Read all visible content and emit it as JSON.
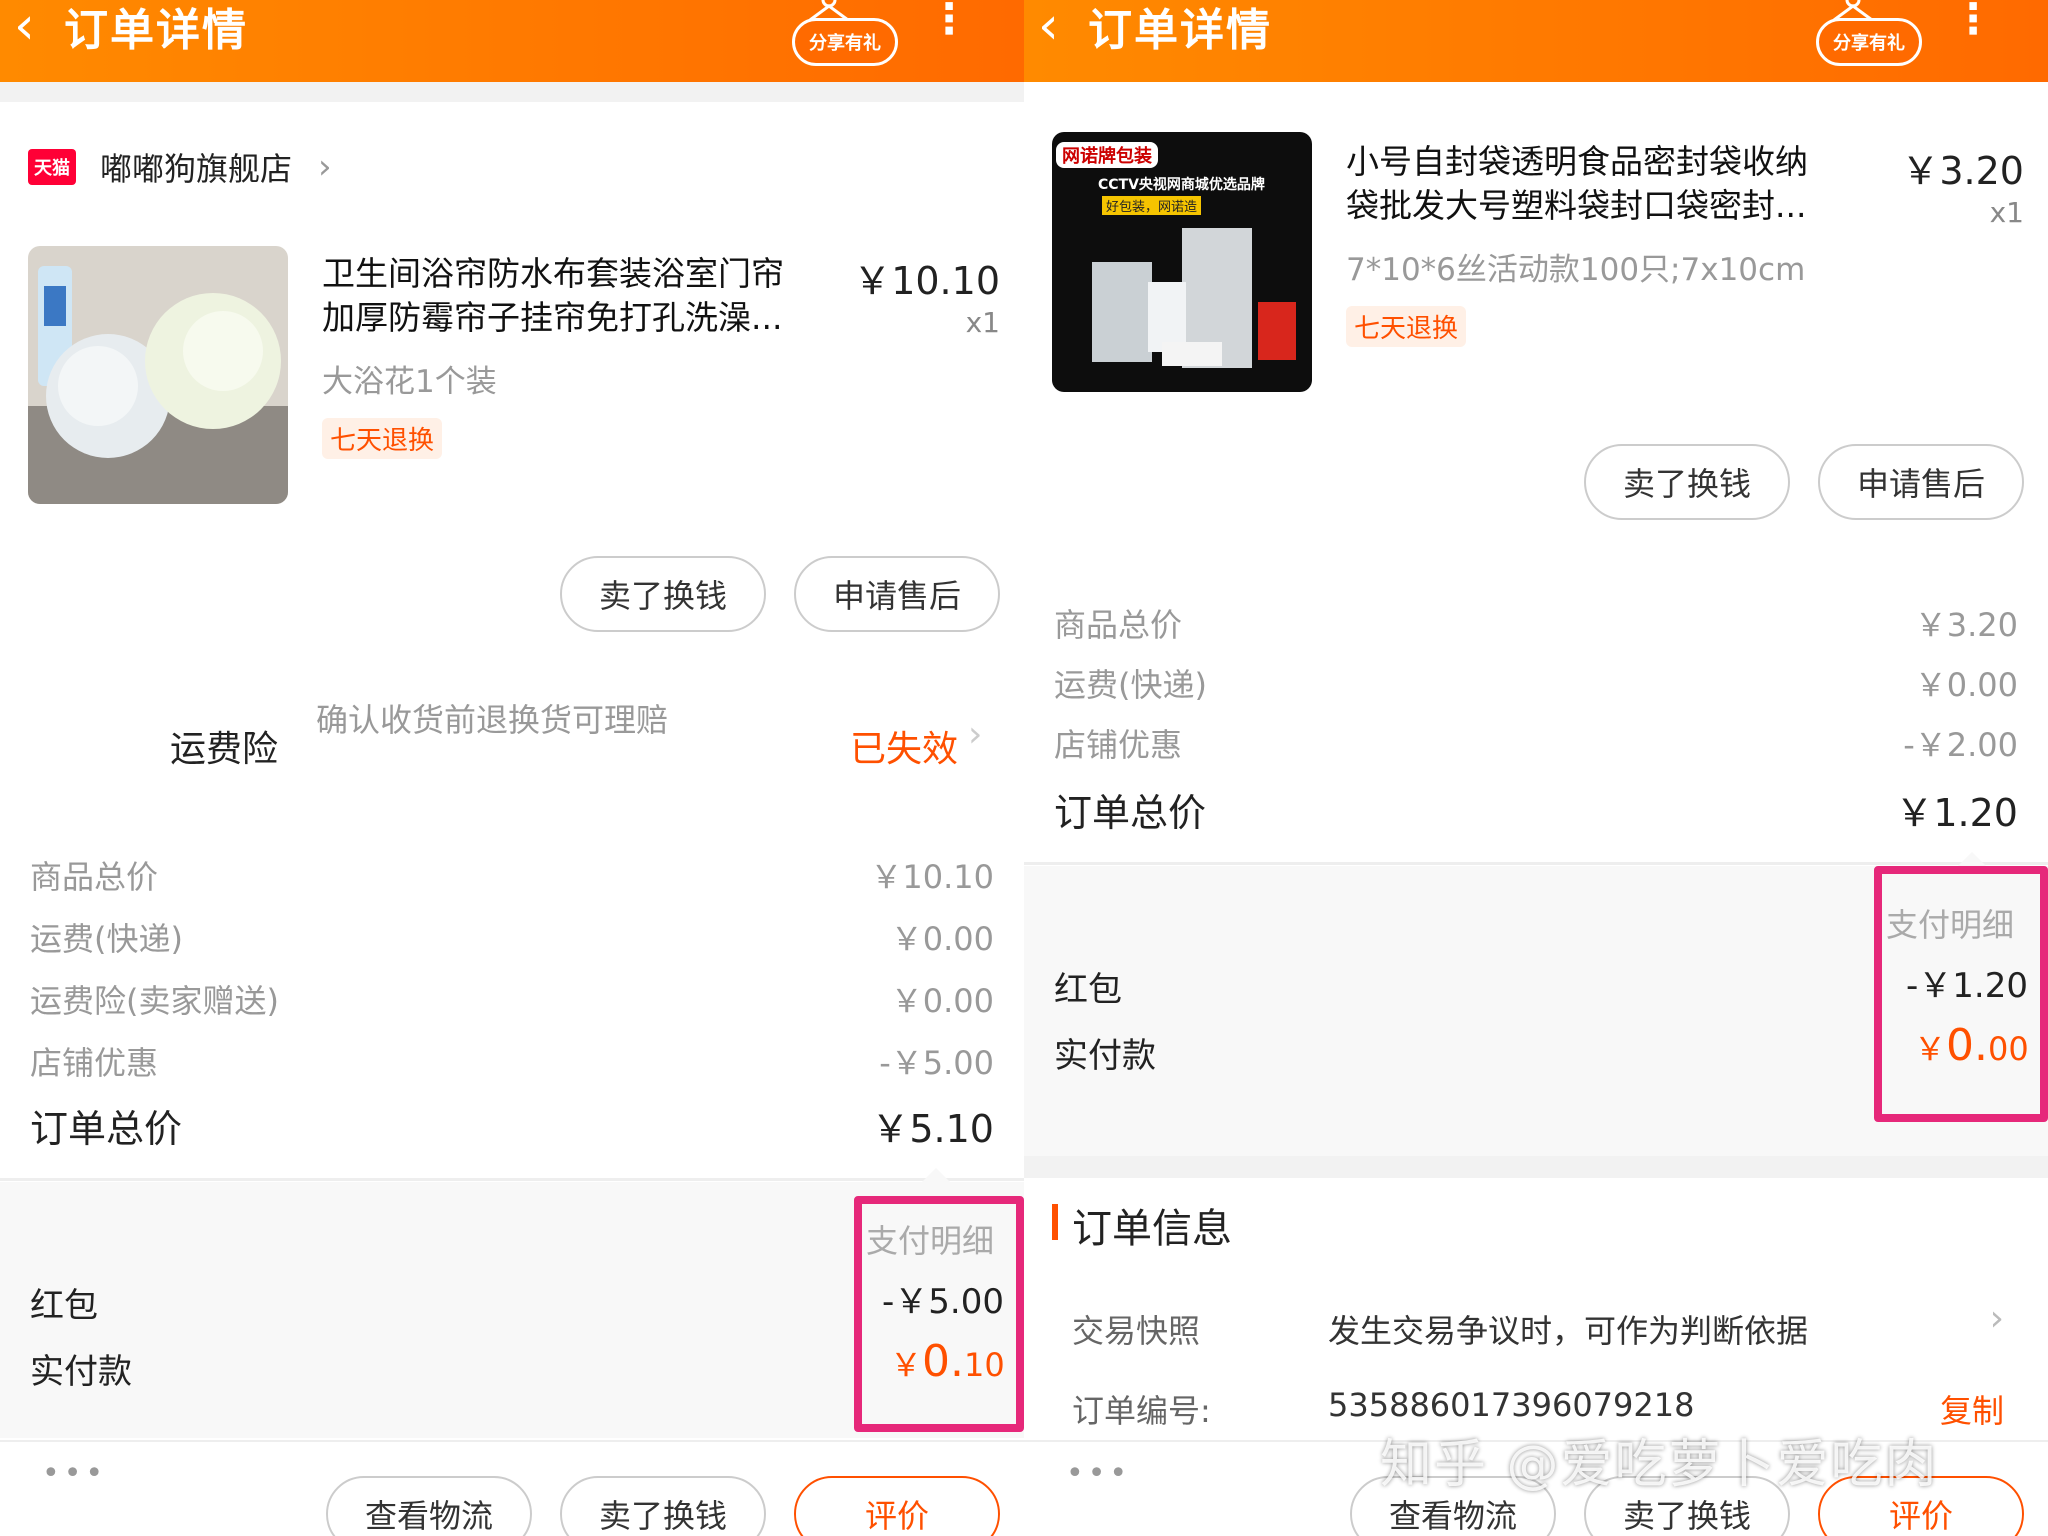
{
  "topbar": {
    "back_glyph": "‹",
    "title": "订单详情",
    "share_label": "分享有礼",
    "more_glyph": "⋮"
  },
  "left": {
    "store": {
      "badge": "天猫",
      "name": "嘟嘟狗旗舰店",
      "chevron": "›"
    },
    "product": {
      "title_line1": "卫生间浴帘防水布套装浴室门帘",
      "title_line2": "加厚防霉帘子挂帘免打孔洗澡...",
      "price": "￥10.10",
      "qty": "x1",
      "sku": "大浴花1个装",
      "tag": "七天退换"
    },
    "buttons": {
      "sell": "卖了换钱",
      "after_sale": "申请售后"
    },
    "insurance": {
      "label": "运费险",
      "desc": "确认收货前退换货可理赔",
      "status": "已失效",
      "chevron": "›"
    },
    "summary": [
      {
        "k": "商品总价",
        "v": "￥10.10"
      },
      {
        "k": "运费(快递)",
        "v": "￥0.00"
      },
      {
        "k": "运费险(卖家赠送)",
        "v": "￥0.00"
      },
      {
        "k": "店铺优惠",
        "v": "-￥5.00"
      }
    ],
    "total": {
      "k": "订单总价",
      "v": "￥5.10"
    },
    "payment": {
      "detail": "支付明细",
      "red_packet": "红包",
      "red_packet_amt": "-￥5.00",
      "paid_label": "实付款",
      "paid_currency": "￥",
      "paid_int": "0.",
      "paid_dec": "10"
    },
    "bottom": {
      "dots": "•••",
      "logistics": "查看物流",
      "sell": "卖了换钱",
      "review": "评价"
    }
  },
  "right": {
    "product": {
      "title_line1": "小号自封袋透明食品密封袋收纳",
      "title_line2": "袋批发大号塑料袋封口袋密封...",
      "price": "￥3.20",
      "qty": "x1",
      "sku": "7*10*6丝活动款100只;7x10cm",
      "tag": "七天退换",
      "image_brand": "网诺牌包装",
      "image_caption": "CCTV央视网商城优选品牌",
      "image_slogan": "好包装，网诺造"
    },
    "buttons": {
      "sell": "卖了换钱",
      "after_sale": "申请售后"
    },
    "summary": [
      {
        "k": "商品总价",
        "v": "￥3.20"
      },
      {
        "k": "运费(快递)",
        "v": "￥0.00"
      },
      {
        "k": "店铺优惠",
        "v": "-￥2.00"
      }
    ],
    "total": {
      "k": "订单总价",
      "v": "￥1.20"
    },
    "payment": {
      "detail": "支付明细",
      "red_packet": "红包",
      "red_packet_amt": "-￥1.20",
      "paid_label": "实付款",
      "paid_currency": "￥",
      "paid_int": "0.",
      "paid_dec": "00"
    },
    "order_info": {
      "title": "订单信息",
      "snapshot_k": "交易快照",
      "snapshot_v": "发生交易争议时，可作为判断依据",
      "snapshot_chevron": "›",
      "order_no_k": "订单编号:",
      "order_no_v": "535886017396079218",
      "copy": "复制"
    },
    "bottom": {
      "dots": "•••",
      "logistics": "查看物流",
      "sell": "卖了换钱",
      "review": "评价"
    }
  },
  "watermark": "知乎 @爱吃萝卜爱吃肉",
  "colors": {
    "accent": "#ff5000",
    "topbar": "#ff7a00",
    "highlight": "#e6287a"
  }
}
